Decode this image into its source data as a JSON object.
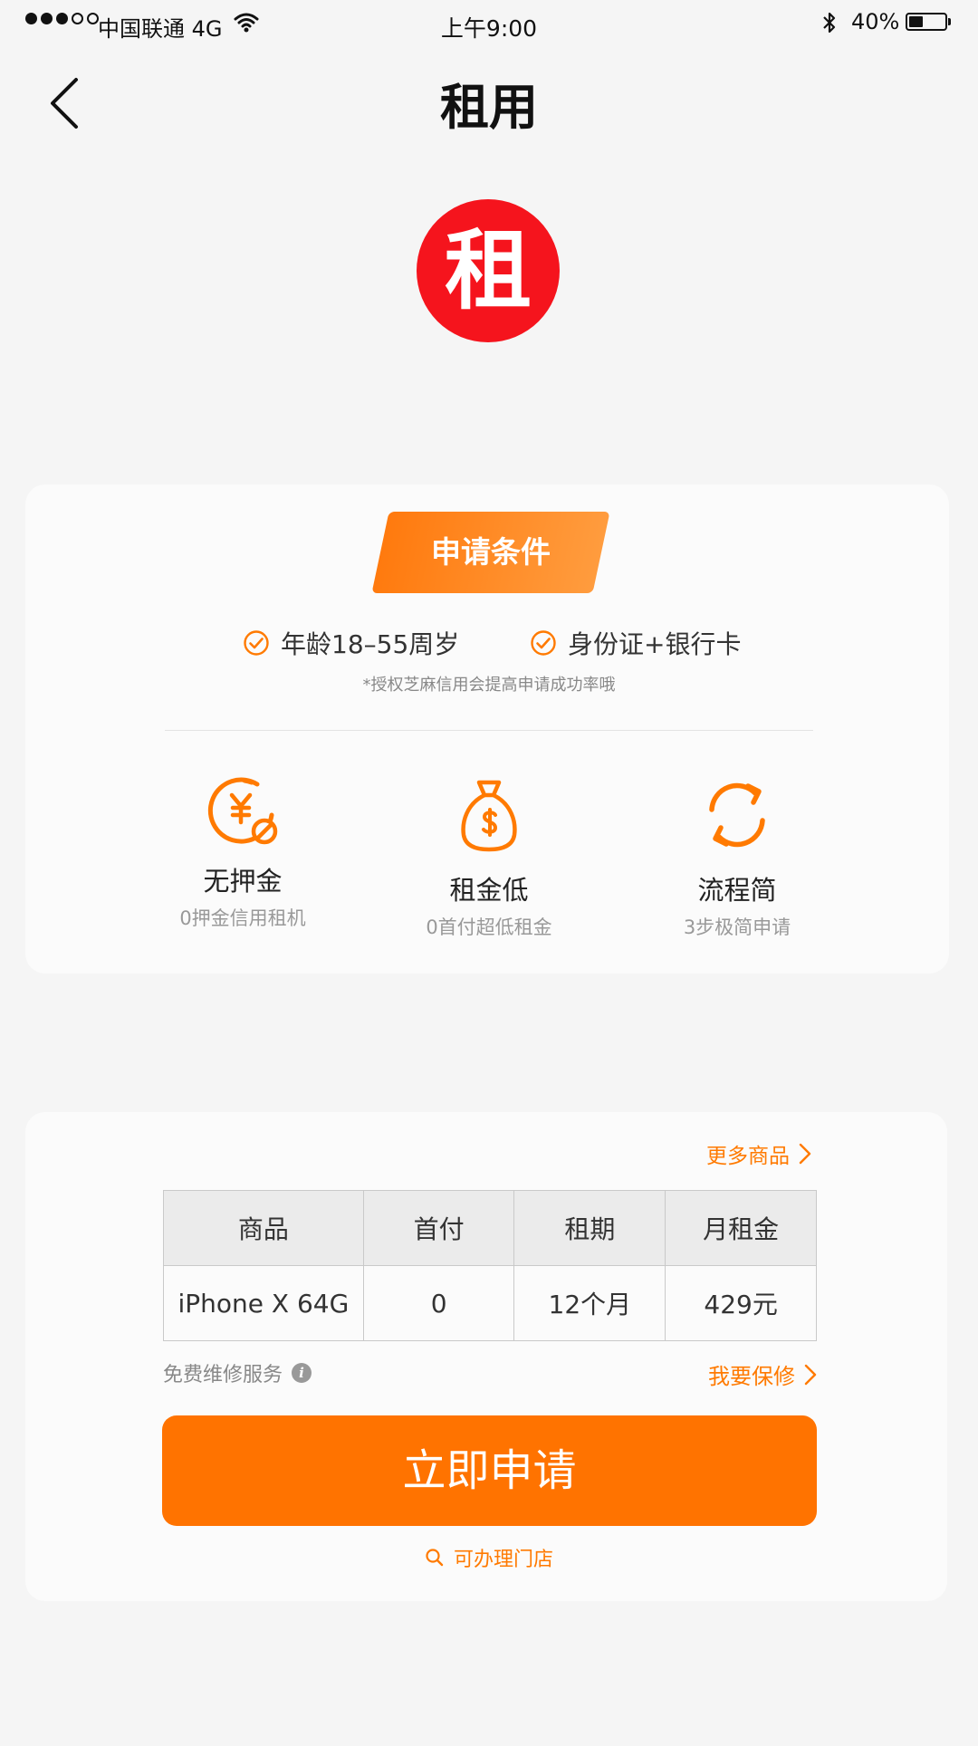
{
  "status_bar": {
    "carrier": "中国联通 4G",
    "time": "上午9:00",
    "battery_text": "40%",
    "battery_level": 0.4
  },
  "nav": {
    "title": "租用"
  },
  "logo": {
    "char": "租"
  },
  "conditions": {
    "tag_label": "申请条件",
    "items": [
      "年龄18–55周岁",
      "身份证+银行卡"
    ],
    "note": "*授权芝麻信用会提高申请成功率哦"
  },
  "features": [
    {
      "title": "无押金",
      "subtitle": "0押金信用租机",
      "icon": "no-deposit-icon"
    },
    {
      "title": "租金低",
      "subtitle": "0首付超低租金",
      "icon": "money-bag-icon"
    },
    {
      "title": "流程简",
      "subtitle": "3步极简申请",
      "icon": "refresh-icon"
    }
  ],
  "product_section": {
    "more_link": "更多商品",
    "table": {
      "headers": [
        "商品",
        "首付",
        "租期",
        "月租金"
      ],
      "rows": [
        [
          "iPhone X 64G",
          "0",
          "12个月",
          "429元"
        ]
      ]
    },
    "service_label": "免费维修服务",
    "repair_link": "我要保修",
    "apply_button": "立即申请",
    "store_link": "可办理门店"
  },
  "colors": {
    "accent": "#FF7300",
    "logo_red": "#F5141D",
    "background": "#F5F5F5"
  }
}
